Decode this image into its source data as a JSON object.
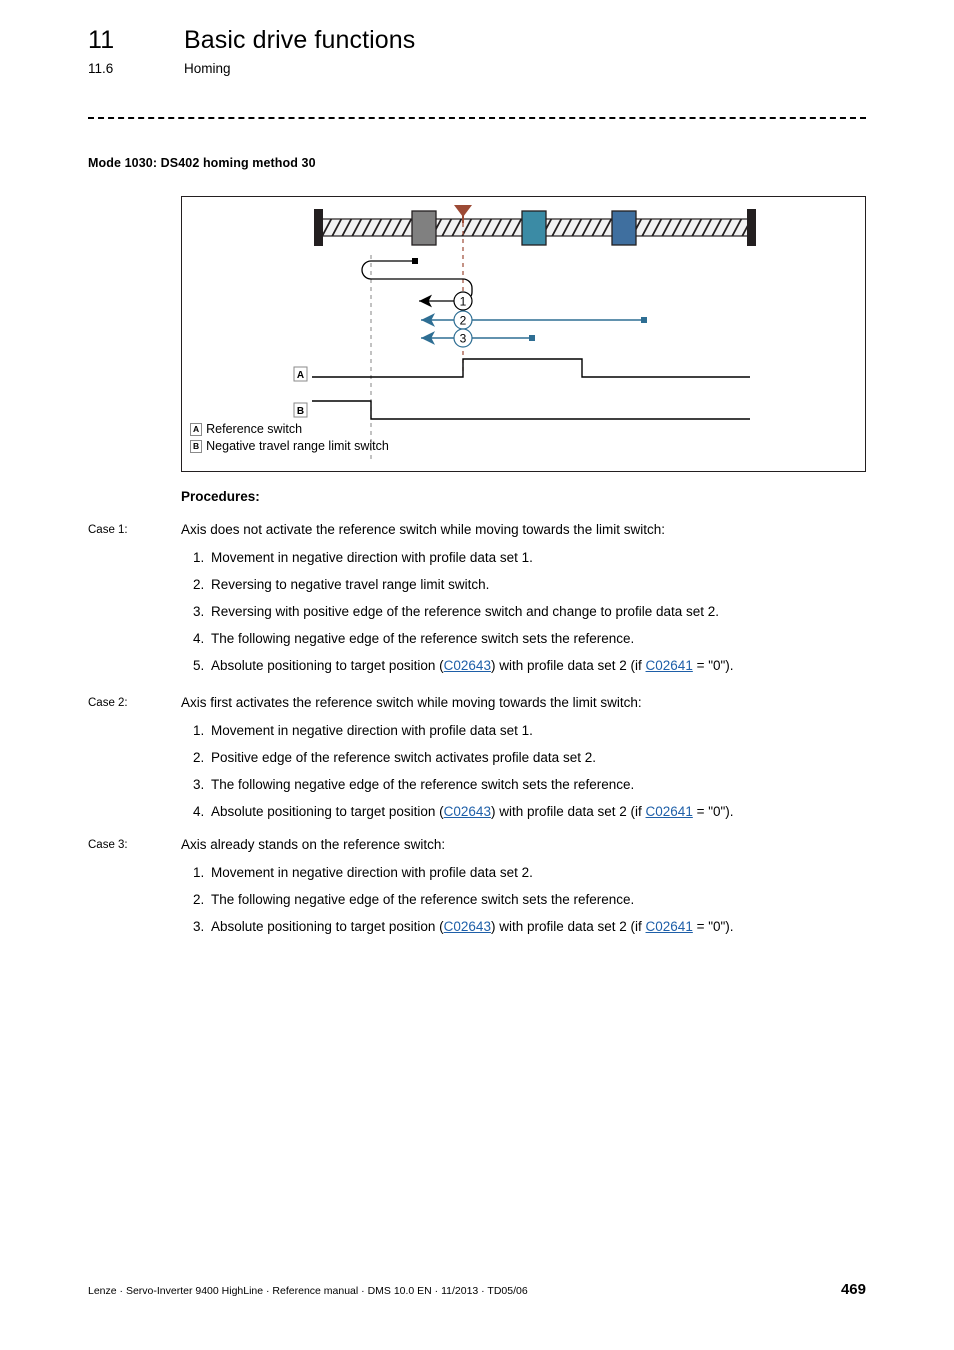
{
  "header": {
    "chapter_number": "11",
    "chapter_title": "Basic drive functions",
    "section_number": "11.6",
    "section_title": "Homing"
  },
  "figure": {
    "caption": "Mode 1030: DS402 homing method 30",
    "legend": [
      {
        "key": "A",
        "text": "Reference switch"
      },
      {
        "key": "B",
        "text": "Negative travel range limit switch"
      }
    ],
    "markers": [
      "1",
      "2",
      "3"
    ],
    "signals": [
      {
        "key": "A",
        "name": "reference-switch-signal"
      },
      {
        "key": "B",
        "name": "negative-limit-switch-signal"
      }
    ],
    "colors": {
      "rail_stop": "#231f20",
      "block_gray": "#808080",
      "block_teal": "#3b8ba5",
      "block_blue": "#3f6f9f",
      "arrow_blue": "#2e6e93",
      "marker_red": "#9c4a35",
      "guide_gray": "#999999"
    }
  },
  "procedures": {
    "title": "Procedures:",
    "cases": [
      {
        "label": "Case 1:",
        "heading": "Axis does not activate the reference switch while moving towards the limit switch:",
        "steps": [
          {
            "num": "1.",
            "pre": "Movement in negative direction with profile data set 1.",
            "link1": "",
            "mid": "",
            "link2": "",
            "post": ""
          },
          {
            "num": "2.",
            "pre": "Reversing to negative travel range limit switch.",
            "link1": "",
            "mid": "",
            "link2": "",
            "post": ""
          },
          {
            "num": "3.",
            "pre": "Reversing with positive edge of the reference switch and change to profile data set 2.",
            "link1": "",
            "mid": "",
            "link2": "",
            "post": ""
          },
          {
            "num": "4.",
            "pre": "The following negative edge of the reference switch sets the reference.",
            "link1": "",
            "mid": "",
            "link2": "",
            "post": ""
          },
          {
            "num": "5.",
            "pre": "Absolute positioning to target position (",
            "link1": "C02643",
            "mid": ") with profile data set 2 (if ",
            "link2": "C02641",
            "post": " = \"0\")."
          }
        ]
      },
      {
        "label": "Case 2:",
        "heading": "Axis first activates the reference switch while moving towards the limit switch:",
        "steps": [
          {
            "num": "1.",
            "pre": "Movement in negative direction with profile data set 1.",
            "link1": "",
            "mid": "",
            "link2": "",
            "post": ""
          },
          {
            "num": "2.",
            "pre": "Positive edge of the reference switch activates profile data set 2.",
            "link1": "",
            "mid": "",
            "link2": "",
            "post": ""
          },
          {
            "num": "3.",
            "pre": "The following negative edge of the reference switch sets the reference.",
            "link1": "",
            "mid": "",
            "link2": "",
            "post": ""
          },
          {
            "num": "4.",
            "pre": "Absolute positioning to target position (",
            "link1": "C02643",
            "mid": ") with profile data set 2 (if ",
            "link2": "C02641",
            "post": " = \"0\")."
          }
        ]
      },
      {
        "label": "Case 3:",
        "heading": "Axis already stands on the reference switch:",
        "steps": [
          {
            "num": "1.",
            "pre": "Movement in negative direction with profile data set 2.",
            "link1": "",
            "mid": "",
            "link2": "",
            "post": ""
          },
          {
            "num": "2.",
            "pre": "The following negative edge of the reference switch sets the reference.",
            "link1": "",
            "mid": "",
            "link2": "",
            "post": ""
          },
          {
            "num": "3.",
            "pre": "Absolute positioning to target position (",
            "link1": "C02643",
            "mid": ") with profile data set 2 (if ",
            "link2": "C02641",
            "post": " = \"0\")."
          }
        ]
      }
    ]
  },
  "footer": {
    "text": "Lenze · Servo-Inverter 9400 HighLine · Reference manual · DMS 10.0 EN · 11/2013 · TD05/06",
    "page": "469"
  }
}
